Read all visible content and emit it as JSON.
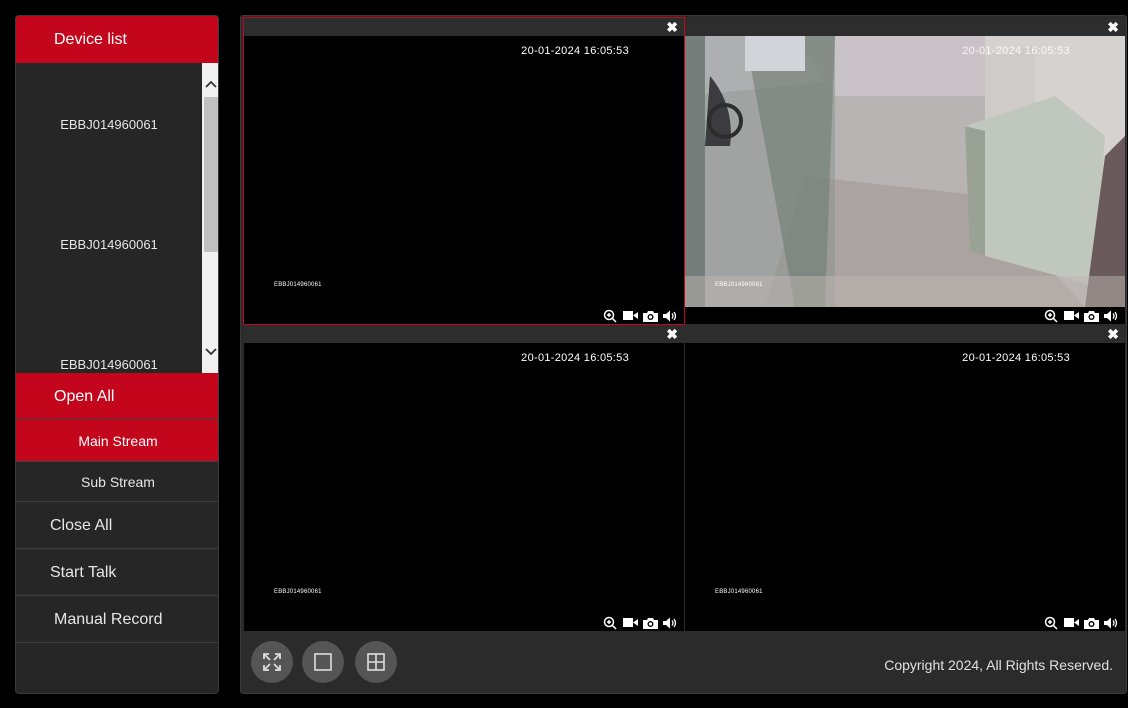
{
  "sidebar": {
    "title": "Device list",
    "devices": [
      "EBBJ014960061",
      "EBBJ014960061",
      "EBBJ014960061"
    ],
    "open_all": "Open All",
    "main_stream": "Main Stream",
    "sub_stream": "Sub Stream",
    "close_all": "Close All",
    "start_talk": "Start Talk",
    "manual_record": "Manual Record"
  },
  "panes": [
    {
      "timestamp": "20-01-2024 16:05:53",
      "cam_id": "EBBJ014960061"
    },
    {
      "timestamp": "20-01-2024 16:05:53",
      "cam_id": "EBBJ014960061"
    },
    {
      "timestamp": "20-01-2024 16:05:53",
      "cam_id": "EBBJ014960061"
    },
    {
      "timestamp": "20-01-2024 16:05:53",
      "cam_id": "EBBJ014960061"
    }
  ],
  "pane_controls": {
    "close": "✖",
    "icons": [
      "zoom-in-icon",
      "video-record-icon",
      "camera-snapshot-icon",
      "speaker-icon"
    ]
  },
  "toolbar": {
    "icons": [
      "fullscreen-icon",
      "single-view-icon",
      "quad-view-icon"
    ]
  },
  "footer": {
    "copyright": "Copyright 2024, All Rights Reserved."
  },
  "colors": {
    "accent": "#c4061d",
    "panel": "#262626",
    "background": "#000000"
  }
}
